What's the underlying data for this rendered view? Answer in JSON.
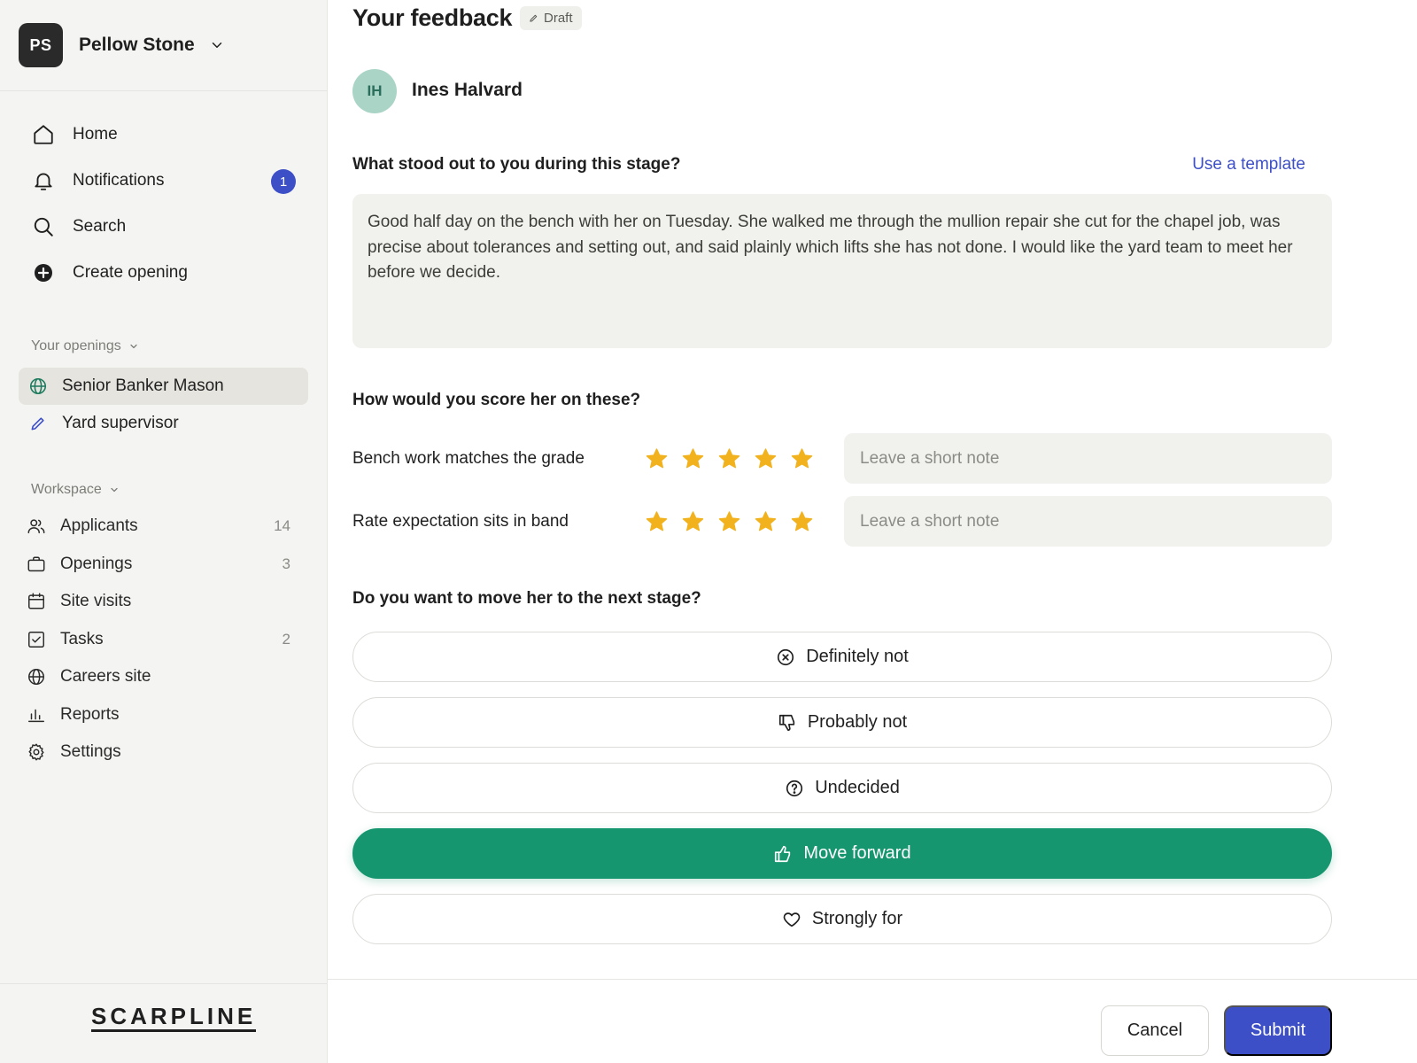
{
  "workspace": {
    "initials": "PS",
    "name": "Pellow Stone"
  },
  "nav": [
    {
      "label": "Home",
      "icon": "home-icon"
    },
    {
      "label": "Notifications",
      "icon": "bell-icon",
      "badge": "1"
    },
    {
      "label": "Search",
      "icon": "search-icon"
    },
    {
      "label": "Create opening",
      "icon": "plus-circle-icon"
    }
  ],
  "openings": {
    "section_label": "Your openings",
    "items": [
      {
        "label": "Senior Banker Mason",
        "icon": "globe-icon",
        "active": true
      },
      {
        "label": "Yard supervisor",
        "icon": "pencil-icon",
        "active": false
      }
    ]
  },
  "workspace_section": {
    "section_label": "Workspace",
    "items": [
      {
        "label": "Applicants",
        "icon": "users-icon",
        "count": "14"
      },
      {
        "label": "Openings",
        "icon": "briefcase-icon",
        "count": "3"
      },
      {
        "label": "Site visits",
        "icon": "calendar-icon",
        "count": ""
      },
      {
        "label": "Tasks",
        "icon": "checkbox-icon",
        "count": "2"
      },
      {
        "label": "Careers site",
        "icon": "globe-icon",
        "count": ""
      },
      {
        "label": "Reports",
        "icon": "bar-chart-icon",
        "count": ""
      },
      {
        "label": "Settings",
        "icon": "gear-icon",
        "count": ""
      }
    ]
  },
  "brand": "SCARPLINE",
  "feedback": {
    "title": "Your feedback",
    "status": "Draft",
    "candidate": {
      "initials": "IH",
      "name": "Ines Halvard"
    },
    "q1": "What stood out to you during this stage?",
    "template_link": "Use a template",
    "notes": "Good half day on the bench with her on Tuesday. She walked me through the mullion repair she cut for the chapel job, was precise about tolerances and setting out, and said plainly which lifts she has not done. I would like the yard team to meet her before we decide.",
    "q2": "How would you score her on these?",
    "scores": [
      {
        "label": "Bench work matches the grade",
        "rating": 5,
        "max": 5,
        "note_placeholder": "Leave a short note"
      },
      {
        "label": "Rate expectation sits in band",
        "rating": 5,
        "max": 5,
        "note_placeholder": "Leave a short note"
      }
    ],
    "q3": "Do you want to move her to the next stage?",
    "choices": [
      {
        "label": "Definitely not",
        "icon": "x-circle-icon",
        "selected": false
      },
      {
        "label": "Probably not",
        "icon": "thumbs-down-icon",
        "selected": false
      },
      {
        "label": "Undecided",
        "icon": "question-circle-icon",
        "selected": false
      },
      {
        "label": "Move forward",
        "icon": "thumbs-up-icon",
        "selected": true
      },
      {
        "label": "Strongly for",
        "icon": "heart-icon",
        "selected": false
      }
    ]
  },
  "actions": {
    "cancel": "Cancel",
    "submit": "Submit"
  },
  "colors": {
    "accent": "#3d4fc7",
    "selected": "#16966f",
    "star": "#f2b21e"
  }
}
